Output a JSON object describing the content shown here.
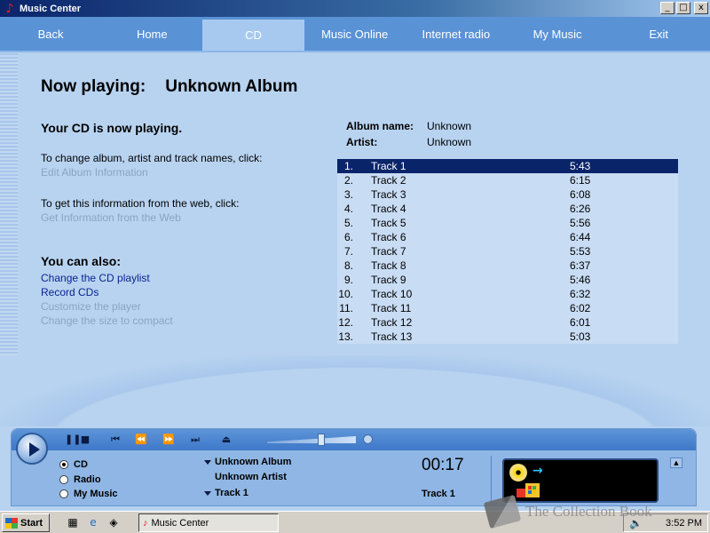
{
  "window": {
    "title": "Music Center",
    "min": "_",
    "max": "□",
    "close": "x"
  },
  "nav": [
    {
      "label": "Back"
    },
    {
      "label": "Home"
    },
    {
      "label": "CD",
      "active": true
    },
    {
      "label": "Music Online"
    },
    {
      "label": "Internet radio"
    },
    {
      "label": "My Music"
    },
    {
      "label": "Exit"
    }
  ],
  "main": {
    "heading": "Now playing:",
    "album_title": "Unknown Album",
    "status": "Your CD is now playing.",
    "change_text": "To change album, artist and track names, click:",
    "edit_link": "Edit Album Information",
    "web_text": "To get this information from the web, click:",
    "web_link": "Get Information from the Web",
    "also_head": "You can also:",
    "also_links": [
      {
        "label": "Change the CD playlist",
        "enabled": true
      },
      {
        "label": "Record CDs",
        "enabled": true
      },
      {
        "label": "Customize the player",
        "enabled": false
      },
      {
        "label": "Change the size to compact",
        "enabled": false
      }
    ],
    "album_label": "Album name:",
    "album_value": "Unknown",
    "artist_label": "Artist:",
    "artist_value": "Unknown",
    "tracks": [
      {
        "num": "1.",
        "name": "Track 1",
        "time": "5:43"
      },
      {
        "num": "2.",
        "name": "Track 2",
        "time": "6:15"
      },
      {
        "num": "3.",
        "name": "Track 3",
        "time": "6:08"
      },
      {
        "num": "4.",
        "name": "Track 4",
        "time": "6:26"
      },
      {
        "num": "5.",
        "name": "Track 5",
        "time": "5:56"
      },
      {
        "num": "6.",
        "name": "Track 6",
        "time": "6:44"
      },
      {
        "num": "7.",
        "name": "Track 7",
        "time": "5:53"
      },
      {
        "num": "8.",
        "name": "Track 8",
        "time": "6:37"
      },
      {
        "num": "9.",
        "name": "Track 9",
        "time": "5:46"
      },
      {
        "num": "10.",
        "name": "Track 10",
        "time": "6:32"
      },
      {
        "num": "11.",
        "name": "Track 11",
        "time": "6:02"
      },
      {
        "num": "12.",
        "name": "Track 12",
        "time": "6:01"
      },
      {
        "num": "13.",
        "name": "Track 13",
        "time": "5:03"
      }
    ],
    "selected_track": 0
  },
  "player": {
    "sources": [
      {
        "label": "CD",
        "selected": true
      },
      {
        "label": "Radio",
        "selected": false
      },
      {
        "label": "My Music",
        "selected": false
      }
    ],
    "album": "Unknown Album",
    "artist": "Unknown Artist",
    "track": "Track 1",
    "elapsed": "00:17",
    "current_track": "Track 1",
    "controls": {
      "pause": "❚❚",
      "stop": "■",
      "prev": "⏮",
      "rew": "⏪",
      "ffwd": "⏩",
      "next": "⏭",
      "eject": "⏏"
    }
  },
  "taskbar": {
    "start": "Start",
    "task": "Music Center",
    "clock": "3:52 PM"
  },
  "watermark": "The Collection Book"
}
